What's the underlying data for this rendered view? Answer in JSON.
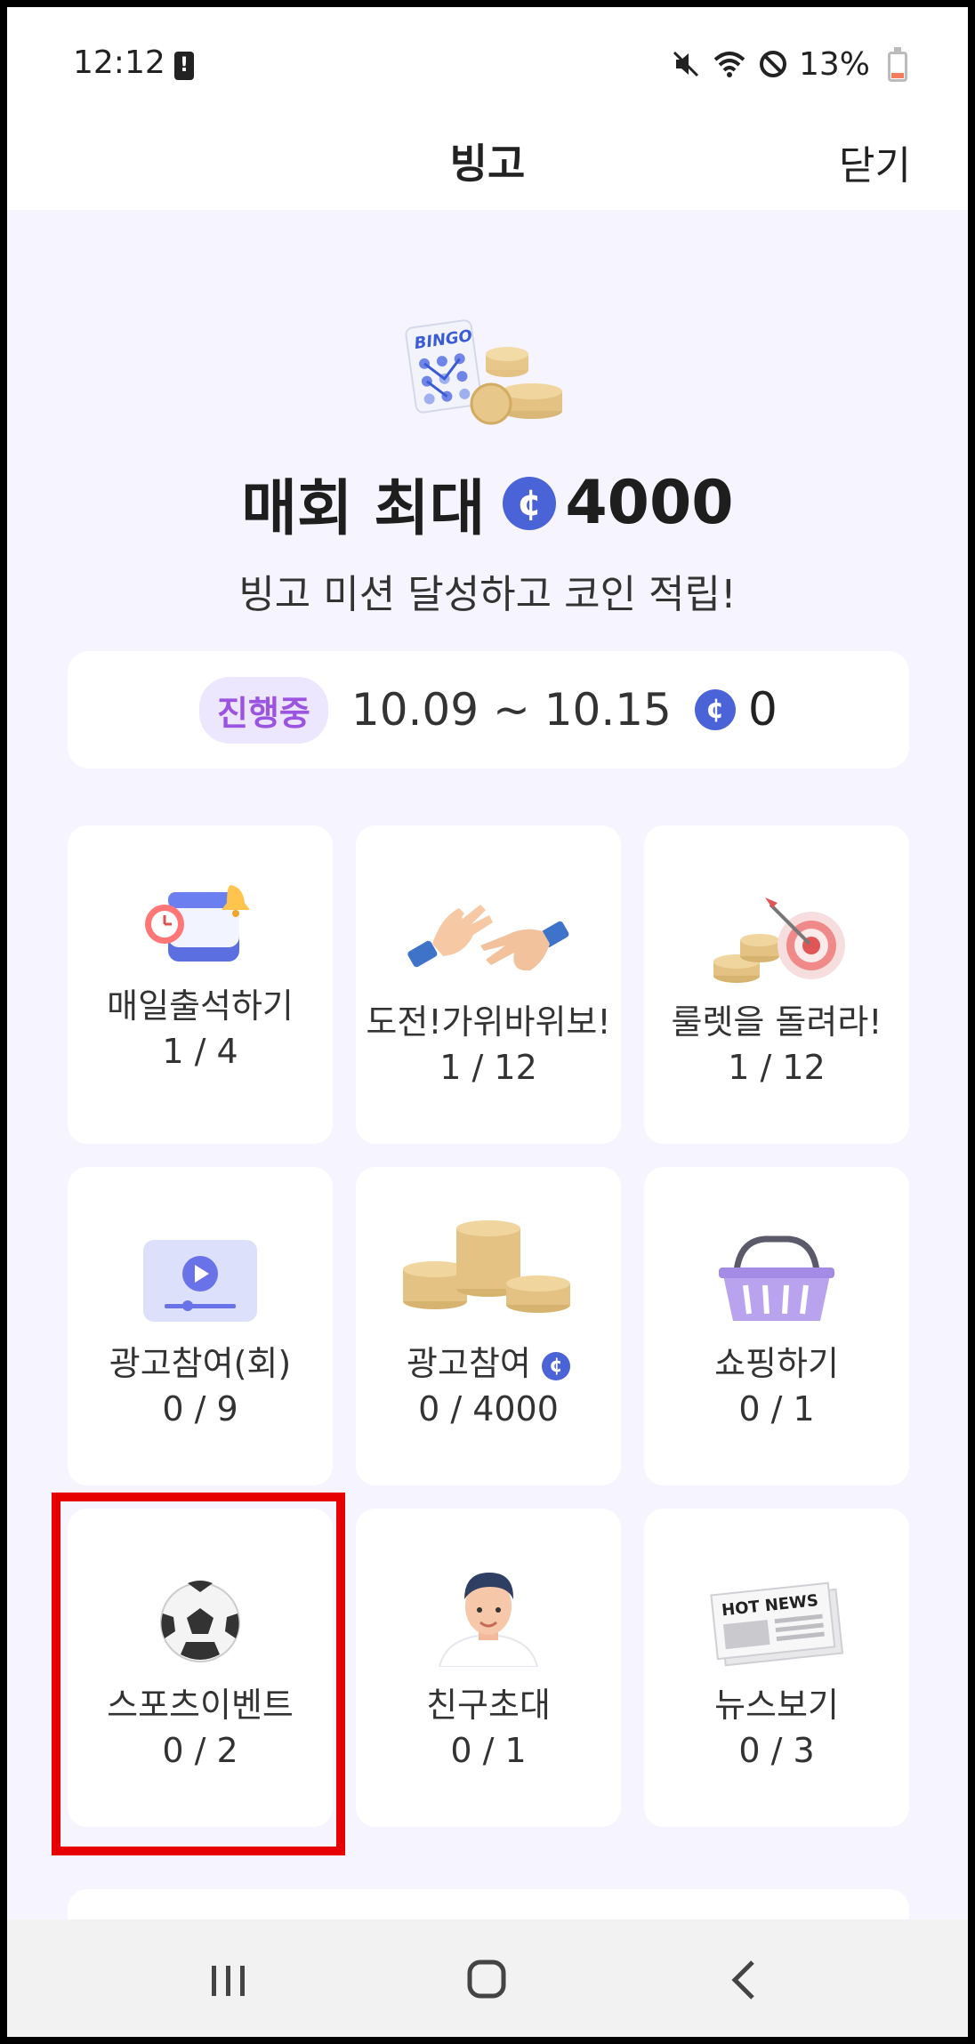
{
  "status_bar": {
    "time": "12:12",
    "battery": "13%"
  },
  "header": {
    "title": "빙고",
    "close_label": "닫기"
  },
  "hero": {
    "title_prefix": "매회 최대",
    "max_coins": "4000",
    "subtitle": "빙고 미션 달성하고 코인 적립!"
  },
  "period": {
    "badge": "진행중",
    "range": "10.09 ~ 10.15",
    "coins": "0"
  },
  "coin_symbol": "¢",
  "missions": [
    {
      "label": "매일출석하기",
      "count": "1 / 4",
      "icon": "calendar-bell-icon"
    },
    {
      "label": "도전!가위바위보!",
      "count": "1 / 12",
      "icon": "rock-paper-scissors-hands-icon"
    },
    {
      "label": "룰렛을 돌려라!",
      "count": "1 / 12",
      "icon": "target-coins-icon"
    },
    {
      "label": "광고참여(회)",
      "count": "0 / 9",
      "icon": "video-play-icon"
    },
    {
      "label": "광고참여",
      "count": "0 / 4000",
      "icon": "coin-stacks-icon"
    },
    {
      "label": "쇼핑하기",
      "count": "0 / 1",
      "icon": "shopping-basket-icon"
    },
    {
      "label": "스포츠이벤트",
      "count": "0 / 2",
      "icon": "soccer-ball-icon"
    },
    {
      "label": "친구초대",
      "count": "0 / 1",
      "icon": "person-avatar-icon"
    },
    {
      "label": "뉴스보기",
      "count": "0 / 3",
      "icon": "newspaper-icon"
    }
  ],
  "news_icon_text": "HOT NEWS",
  "bingo_icon_text": "BINGO",
  "colors": {
    "accent_coin": "#4a63d6",
    "badge_text": "#9b54e0",
    "highlight": "#e60000"
  }
}
